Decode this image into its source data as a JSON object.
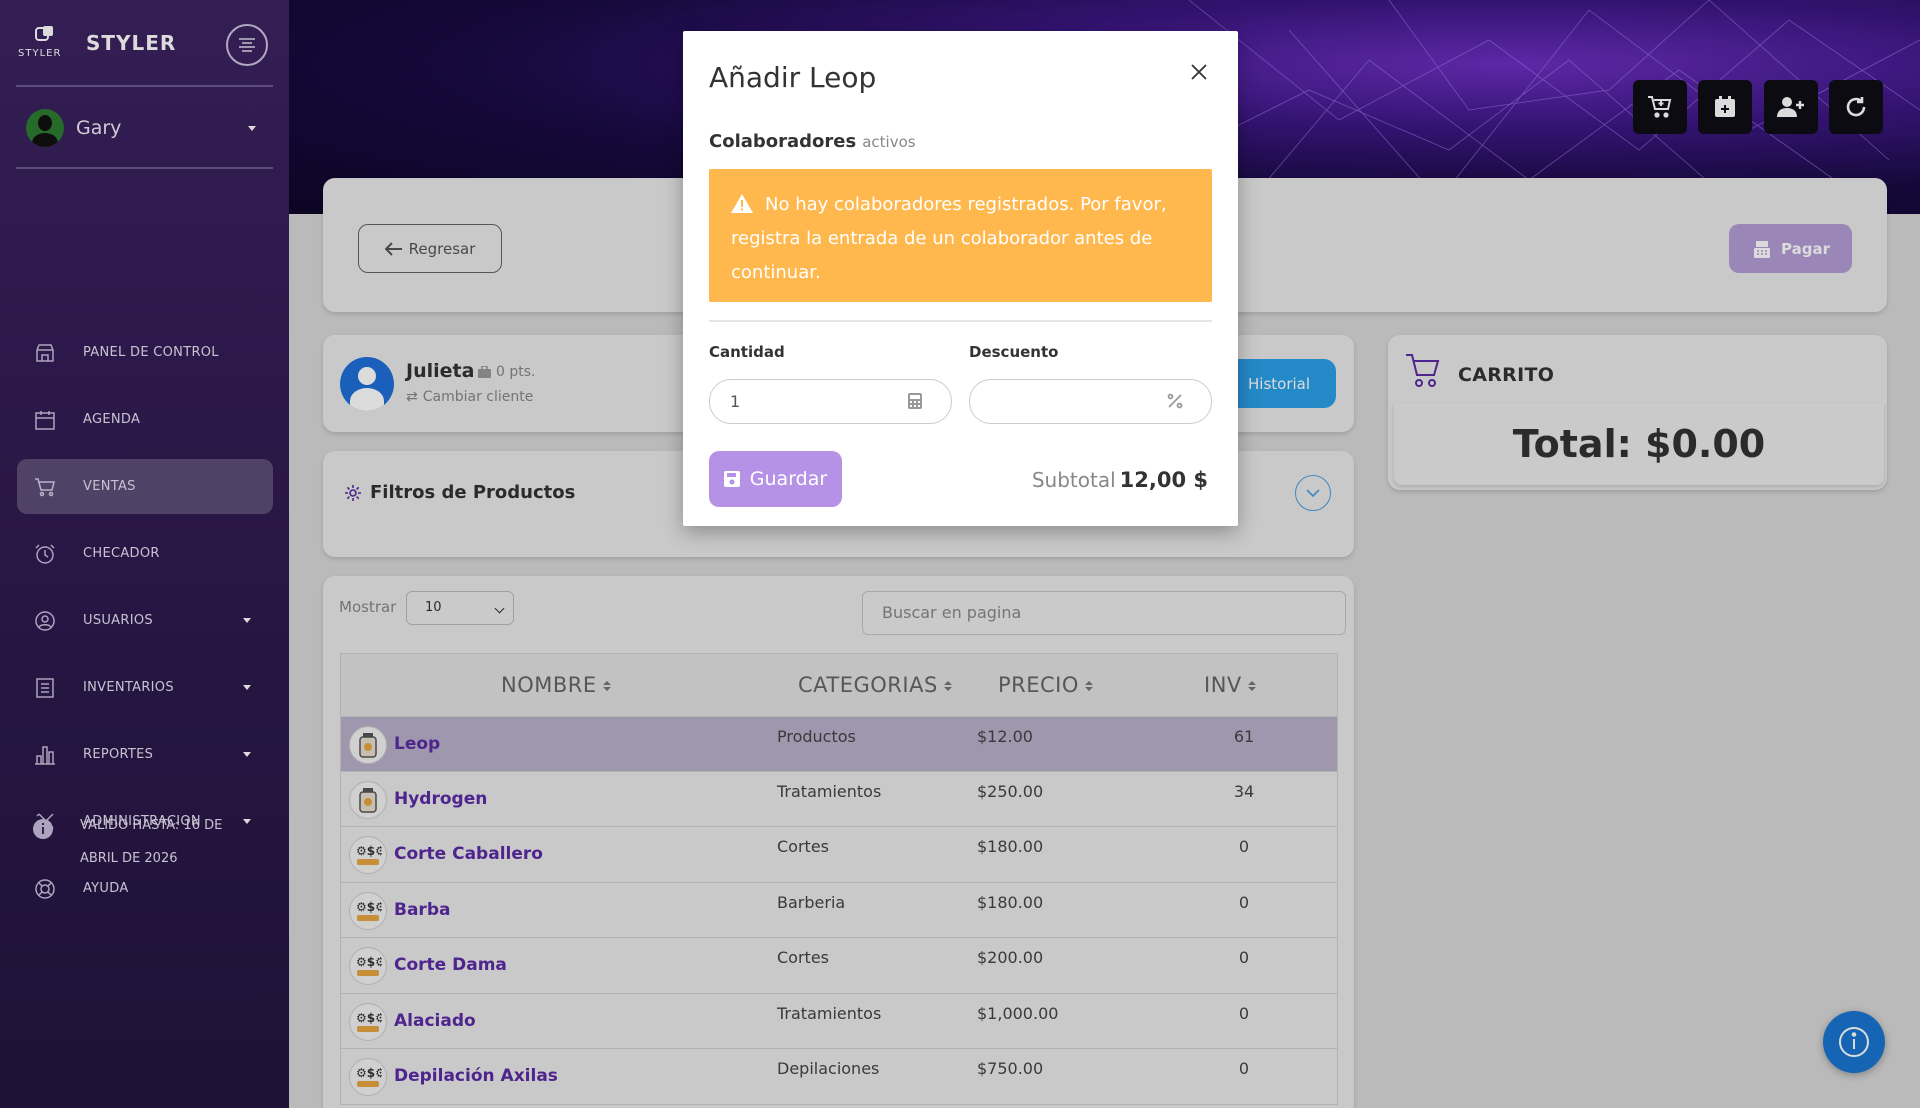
{
  "app": {
    "brand": "STYLER",
    "brand_logo_text": "STYLER"
  },
  "user": {
    "name": "Gary"
  },
  "sidebar": {
    "items": [
      {
        "label": "PANEL DE CONTROL",
        "icon": "store-icon",
        "has_caret": false,
        "active": false
      },
      {
        "label": "AGENDA",
        "icon": "calendar-icon",
        "has_caret": false,
        "active": false
      },
      {
        "label": "VENTAS",
        "icon": "cart-icon",
        "has_caret": false,
        "active": true
      },
      {
        "label": "CHECADOR",
        "icon": "alarm-clock-icon",
        "has_caret": false,
        "active": false
      },
      {
        "label": "USUARIOS",
        "icon": "user-circle-icon",
        "has_caret": true,
        "active": false
      },
      {
        "label": "INVENTARIOS",
        "icon": "list-icon",
        "has_caret": true,
        "active": false
      },
      {
        "label": "REPORTES",
        "icon": "bar-chart-icon",
        "has_caret": true,
        "active": false
      },
      {
        "label": "ADMINISTRACION",
        "icon": "tools-icon",
        "has_caret": true,
        "active": false
      },
      {
        "label": "AYUDA",
        "icon": "lifebuoy-icon",
        "has_caret": false,
        "active": false
      }
    ],
    "validity": "VALIDO HASTA: 16 DE ABRIL DE 2026"
  },
  "header_buttons": [
    "cart-add-icon",
    "calendar-add-icon",
    "user-add-icon",
    "refresh-icon"
  ],
  "toolbar": {
    "back_label": "Regresar",
    "pay_label": "Pagar"
  },
  "client": {
    "name": "Julieta",
    "points": "0 pts.",
    "change_label": "Cambiar cliente",
    "history_label": "Historial"
  },
  "filters": {
    "title": "Filtros de Productos"
  },
  "listing": {
    "show_label": "Mostrar",
    "show_value": "10",
    "search_placeholder": "Buscar en pagina",
    "columns": [
      "NOMBRE",
      "CATEGORIAS",
      "PRECIO",
      "INV"
    ],
    "rows": [
      {
        "name": "Leop",
        "category": "Productos",
        "price": "$12.00",
        "inv": "61",
        "icon": "product-jar-icon"
      },
      {
        "name": "Hydrogen",
        "category": "Tratamientos",
        "price": "$250.00",
        "inv": "34",
        "icon": "product-jar-icon"
      },
      {
        "name": "Corte Caballero",
        "category": "Cortes",
        "price": "$180.00",
        "inv": "0",
        "icon": "service-icon"
      },
      {
        "name": "Barba",
        "category": "Barberia",
        "price": "$180.00",
        "inv": "0",
        "icon": "service-icon"
      },
      {
        "name": "Corte Dama",
        "category": "Cortes",
        "price": "$200.00",
        "inv": "0",
        "icon": "service-icon"
      },
      {
        "name": "Alaciado",
        "category": "Tratamientos",
        "price": "$1,000.00",
        "inv": "0",
        "icon": "service-icon"
      },
      {
        "name": "Depilación Axilas",
        "category": "Depilaciones",
        "price": "$750.00",
        "inv": "0",
        "icon": "service-icon"
      }
    ]
  },
  "cart": {
    "title": "CARRITO",
    "total": "Total: $0.00"
  },
  "modal": {
    "title": "Añadir Leop",
    "collab_label": "Colaboradores",
    "collab_sub": "activos",
    "alert": "No hay colaboradores registrados. Por favor, registra la entrada de un colaborador antes de continuar.",
    "qty_label": "Cantidad",
    "qty_value": "1",
    "discount_label": "Descuento",
    "discount_value": "",
    "save_label": "Guardar",
    "subtotal_label": "Subtotal",
    "subtotal_value": "12,00 $"
  },
  "colors": {
    "sidebar": "#3d2362",
    "accent": "#5b2aa5",
    "alert": "#ffb84d",
    "save": "#b592e6",
    "history": "#2aa0e8"
  }
}
